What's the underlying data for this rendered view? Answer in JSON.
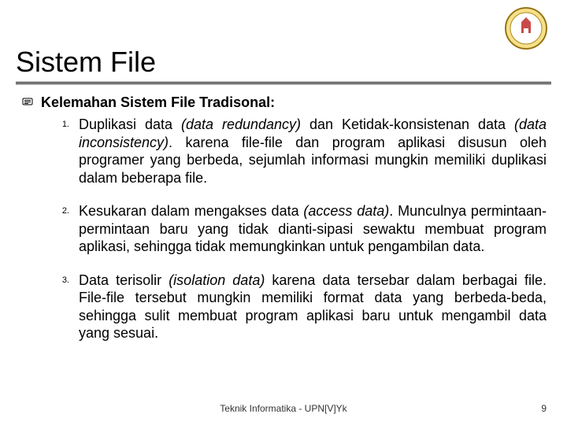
{
  "title": "Sistem File",
  "section_heading": "Kelemahan Sistem File Tradisonal:",
  "points": [
    {
      "num": "1.",
      "plain": "Duplikasi data ",
      "italic1": "(data redundancy)",
      "mid": " dan Ketidak-konsistenan data ",
      "italic2": "(data inconsistency)",
      "tail": ". karena file-file dan program aplikasi disusun oleh programer yang berbeda, sejumlah informasi mungkin memiliki duplikasi dalam beberapa file."
    },
    {
      "num": "2.",
      "plain": "Kesukaran dalam mengakses data ",
      "italic1": "(access data)",
      "mid": ". Munculnya permintaan-permintaan baru yang tidak dianti-sipasi sewaktu membuat program aplikasi, sehingga tidak memungkinkan untuk pengambilan data.",
      "italic2": "",
      "tail": ""
    },
    {
      "num": "3.",
      "plain": "Data terisolir ",
      "italic1": "(isolation data)",
      "mid": " karena data tersebar dalam berbagai file. File-file tersebut mungkin memiliki format data yang berbeda-beda, sehingga sulit membuat program aplikasi baru untuk mengambil data yang sesuai.",
      "italic2": "",
      "tail": ""
    }
  ],
  "footer": "Teknik Informatika - UPN[V]Yk",
  "page_number": "9",
  "logo_alt": "university-seal"
}
